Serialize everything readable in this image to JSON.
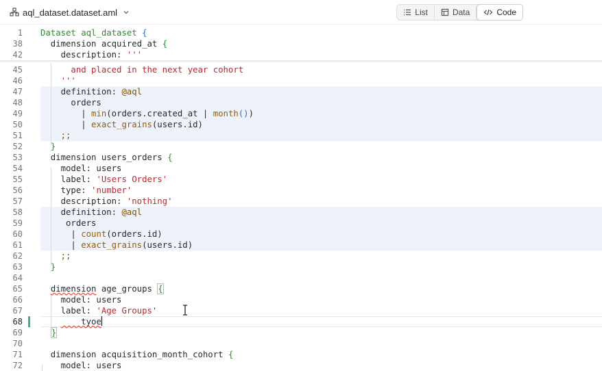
{
  "file_tab": {
    "icon": "dataset-icon",
    "name": "aql_dataset.dataset.aml",
    "chevron": "chevron-down-icon"
  },
  "view_switch": [
    {
      "label": "List",
      "icon": "list-icon",
      "active": false
    },
    {
      "label": "Data",
      "icon": "table-icon",
      "active": false
    },
    {
      "label": "Code",
      "icon": "code-icon",
      "active": true
    }
  ],
  "editor": {
    "current_line": "68",
    "modified_line": "68",
    "lines": [
      {
        "n": "1",
        "text": "Dataset aql_dataset {"
      },
      {
        "n": "38",
        "text": "  dimension acquired_at {"
      },
      {
        "n": "42",
        "text": "    description: '''"
      },
      {
        "n": "45",
        "text": "      and placed in the next year cohort"
      },
      {
        "n": "46",
        "text": "    '''"
      },
      {
        "n": "47",
        "text": "    definition: @aql"
      },
      {
        "n": "48",
        "text": "      orders"
      },
      {
        "n": "49",
        "text": "        | min(orders.created_at | month())"
      },
      {
        "n": "50",
        "text": "        | exact_grains(users.id)"
      },
      {
        "n": "51",
        "text": "    ;;"
      },
      {
        "n": "52",
        "text": "  }"
      },
      {
        "n": "53",
        "text": "  dimension users_orders {"
      },
      {
        "n": "54",
        "text": "    model: users"
      },
      {
        "n": "55",
        "text": "    label: 'Users Orders'"
      },
      {
        "n": "56",
        "text": "    type: 'number'"
      },
      {
        "n": "57",
        "text": "    description: 'nothing'"
      },
      {
        "n": "58",
        "text": "    definition: @aql"
      },
      {
        "n": "59",
        "text": "     orders"
      },
      {
        "n": "60",
        "text": "      | count(orders.id)"
      },
      {
        "n": "61",
        "text": "      | exact_grains(users.id)"
      },
      {
        "n": "62",
        "text": "    ;;"
      },
      {
        "n": "63",
        "text": "  }"
      },
      {
        "n": "64",
        "text": ""
      },
      {
        "n": "65",
        "text": "  dimension age_groups {"
      },
      {
        "n": "66",
        "text": "    model: users"
      },
      {
        "n": "67",
        "text": "    label: 'Age Groups'"
      },
      {
        "n": "68",
        "text": "    tyoe"
      },
      {
        "n": "69",
        "text": "  }"
      },
      {
        "n": "70",
        "text": ""
      },
      {
        "n": "71",
        "text": "  dimension acquisition_month_cohort {"
      },
      {
        "n": "72",
        "text": "    model: users"
      }
    ]
  }
}
